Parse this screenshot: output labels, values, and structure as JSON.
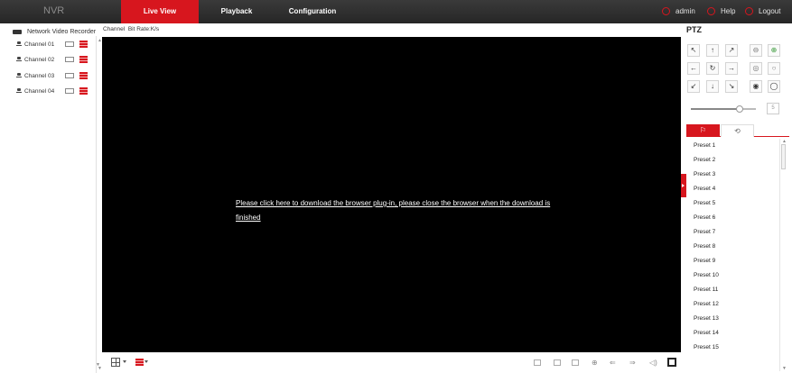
{
  "header": {
    "logo": "NVR",
    "nav": [
      {
        "label": "Live View"
      },
      {
        "label": "Playback"
      },
      {
        "label": "Configuration"
      }
    ],
    "user": "admin",
    "help": "Help",
    "logout": "Logout",
    "accent": "#d7161e"
  },
  "sidebar": {
    "device": "Network Video Recorder",
    "channels": [
      {
        "label": "Channel 01"
      },
      {
        "label": "Channel 02"
      },
      {
        "label": "Channel 03"
      },
      {
        "label": "Channel 04"
      }
    ]
  },
  "infobar": {
    "text": "Channel  Bit Rate:K/s"
  },
  "video": {
    "message": "Please click here to download the browser plug-in, please close the browser when the download is finished"
  },
  "ptz": {
    "title": "PTZ",
    "arrows": [
      "↖",
      "↑",
      "↗",
      "←",
      "↻",
      "→",
      "↙",
      "↓",
      "↘"
    ],
    "speed_value": "5",
    "speed_fraction": 0.75,
    "presets": [
      "Preset 1",
      "Preset 2",
      "Preset 3",
      "Preset 4",
      "Preset 5",
      "Preset 6",
      "Preset 7",
      "Preset 8",
      "Preset 9",
      "Preset 10",
      "Preset 11",
      "Preset 12",
      "Preset 13",
      "Preset 14",
      "Preset 15"
    ]
  }
}
